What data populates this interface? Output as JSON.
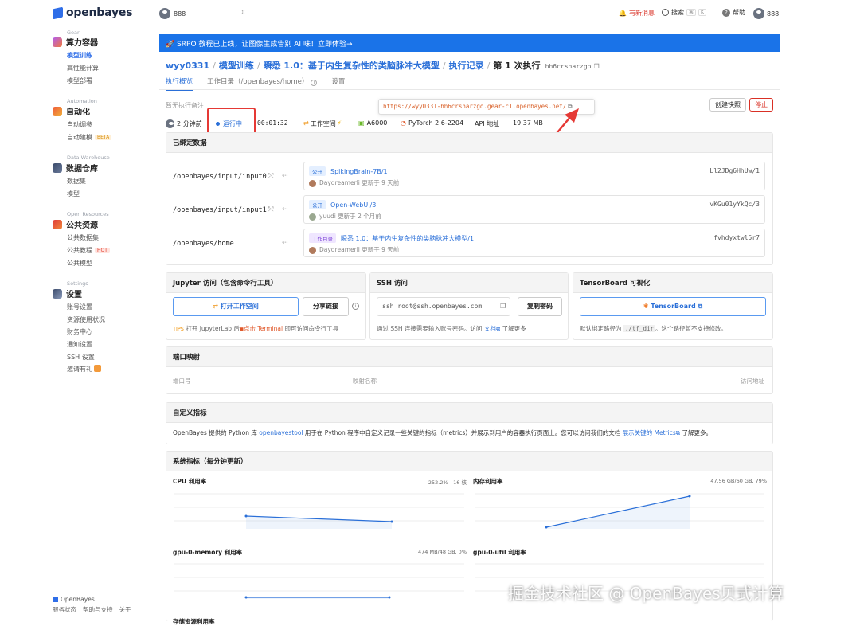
{
  "brand": "openbayes",
  "sidebar": {
    "groups": [
      {
        "caption": "Gear",
        "title": "算力容器",
        "items": [
          {
            "label": "模型训练",
            "active": true
          },
          {
            "label": "高性能计算"
          },
          {
            "label": "模型部署"
          }
        ]
      },
      {
        "caption": "Automation",
        "title": "自动化",
        "items": [
          {
            "label": "自动调参"
          },
          {
            "label": "自动建模",
            "tag": "BETA"
          }
        ]
      },
      {
        "caption": "Data Warehouse",
        "title": "数据仓库",
        "items": [
          {
            "label": "数据集"
          },
          {
            "label": "模型"
          }
        ]
      },
      {
        "caption": "Open Resources",
        "title": "公共资源",
        "items": [
          {
            "label": "公共数据集"
          },
          {
            "label": "公共教程",
            "tag": "HOT"
          },
          {
            "label": "公共模型"
          }
        ]
      },
      {
        "caption": "Settings",
        "title": "设置",
        "items": [
          {
            "label": "账号设置"
          },
          {
            "label": "资源使用状况"
          },
          {
            "label": "财务中心"
          },
          {
            "label": "通知设置"
          },
          {
            "label": "SSH 设置"
          },
          {
            "label": "邀请有礼"
          }
        ]
      }
    ],
    "footer_brand": "OpenBayes",
    "footer_links": [
      "服务状态",
      "帮助与支持",
      "关于"
    ]
  },
  "topbar": {
    "workspace": "888",
    "news": "有新消息",
    "search": "搜索",
    "kbd1": "⌘",
    "kbd2": "K",
    "help": "帮助",
    "user": "888"
  },
  "banner": "🚀 SRPO 教程已上线，让图像生成告别 AI 味！立即体验→",
  "breadcrumb": {
    "user": "wyy0331",
    "section": "模型训练",
    "project": "瞬悉 1.0：基于内生复杂性的类脑脉冲大模型",
    "records": "执行记录",
    "current": "第 1 次执行",
    "hash": "hh6crsharzgo"
  },
  "tabs": [
    "执行概览",
    "工作目录（/openbayes/home）",
    "设置"
  ],
  "note_placeholder": "暂无执行备注",
  "url_popup": "https://wyy0331-hh6crsharzgo.gear-c1.openbayes.net/",
  "buttons": {
    "snapshot": "创建快照",
    "stop": "停止"
  },
  "status": {
    "time": "2 分钟前",
    "state": "运行中",
    "elapsed": "00:01:32",
    "workspace": "工作空间",
    "gpu": "A6000",
    "image": "PyTorch 2.6-2204",
    "api": "API 地址",
    "size": "19.37 MB"
  },
  "bound_data": {
    "title": "已绑定数据",
    "rows": [
      {
        "path": "/openbayes/input/input0",
        "badge": "公开",
        "name": "SpikingBrain-7B/1",
        "hash": "Ll2JDg6HhUw/1",
        "user": "Daydreamerli",
        "updated": "更新于 9 天前"
      },
      {
        "path": "/openbayes/input/input1",
        "badge": "公开",
        "name": "Open-WebUI/3",
        "hash": "vKGu01yYkQc/3",
        "user": "yuudi",
        "updated": "更新于 2 个月前"
      },
      {
        "path": "/openbayes/home",
        "badge": "工作目录",
        "name": "瞬悉 1.0：基于内生复杂性的类脑脉冲大模型/1",
        "hash": "fvhdyxtwl5r7",
        "user": "Daydreamerli",
        "updated": "更新于 9 天前"
      }
    ]
  },
  "jupyter": {
    "title": "Jupyter 访问（包含命令行工具）",
    "open": "打开工作空间",
    "share": "分享链接",
    "tips": "TIPS",
    "tip_text1": "打开 JupyterLab 后",
    "tip_link": "点击 Terminal",
    "tip_text2": "即可访问命令行工具"
  },
  "ssh": {
    "title": "SSH 访问",
    "value": "ssh root@ssh.openbayes.com",
    "copy": "复制密码",
    "desc": "通过 SSH 连接需要输入账号密码。访问",
    "doc": "文档",
    "desc2": "了解更多"
  },
  "tensorboard": {
    "title": "TensorBoard 可视化",
    "button": "TensorBoard",
    "desc1": "默认绑定路径为",
    "path": "./tf_dir",
    "desc2": "。这个路径暂不支持修改。"
  },
  "ports": {
    "title": "端口映射",
    "cols": [
      "端口号",
      "映射名称",
      "访问地址"
    ]
  },
  "metrics": {
    "title": "自定义指标",
    "text1": "OpenBayes 提供的 Python 库",
    "lib": "openbayestool",
    "text2": "用于在 Python 程序中自定义记录一些关键的指标（metrics）并展示到用户的容器执行页面上。您可以访问我们的文档",
    "doc": "展示关键的 Metrics",
    "text3": "了解更多。"
  },
  "system": {
    "title": "系统指标（每分钟更新）",
    "charts": [
      {
        "name": "CPU 利用率",
        "value": "252.2% - 16 核"
      },
      {
        "name": "内存利用率",
        "value": "47.56 GB/60 GB, 79%"
      },
      {
        "name": "gpu-0-memory 利用率",
        "value": "474 MB/48 GB, 0%"
      },
      {
        "name": "gpu-0-util 利用率",
        "value": ""
      }
    ],
    "cut_label": "存储资源利用率"
  },
  "chart_data": [
    {
      "type": "area",
      "title": "CPU 利用率",
      "x": [
        1,
        2
      ],
      "values": [
        0.3,
        0.25
      ]
    },
    {
      "type": "area",
      "title": "内存利用率",
      "x": [
        1,
        2
      ],
      "values": [
        0.0,
        1.0
      ]
    },
    {
      "type": "area",
      "title": "gpu-0-memory 利用率",
      "x": [
        1,
        2
      ],
      "values": [
        0.0,
        0.0
      ]
    }
  ],
  "watermark": "掘金技术社区 @ OpenBayes贝式计算",
  "colors": {
    "accent": "#2a6fd8",
    "banner": "#1a73e8",
    "stop": "#d93025",
    "highlight": "#e53935"
  }
}
